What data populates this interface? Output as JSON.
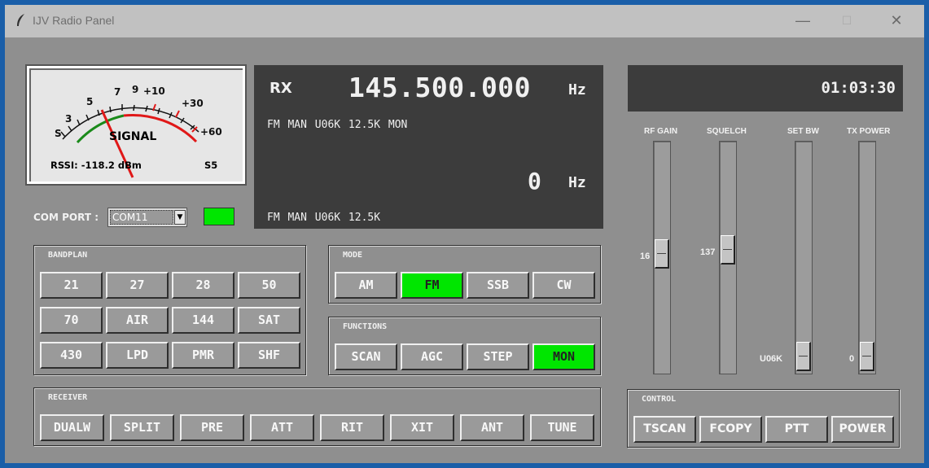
{
  "window": {
    "title": "IJV Radio Panel",
    "icon": "feather-icon"
  },
  "meter": {
    "scale_labels": [
      "S",
      "3",
      "5",
      "7",
      "9",
      "+10",
      "+30",
      "+60"
    ],
    "title": "SIGNAL",
    "rssi": "RSSI: -118.2 dBm",
    "s_level": "S5"
  },
  "com_port": {
    "label": "COM PORT :",
    "value": "COM11",
    "status_color": "#00e600"
  },
  "display": {
    "rx_label": "RX",
    "frequency": "145.500.000",
    "unit": "Hz",
    "status_line": "FM  MAN  U06K 12.5K MON",
    "offset": "0",
    "offset_unit": "Hz",
    "status_line2": "FM  MAN  U06K 12.5K"
  },
  "clock": "01:03:30",
  "bandplan": {
    "title": "BANDPLAN",
    "buttons": [
      "21",
      "27",
      "28",
      "50",
      "70",
      "AIR",
      "144",
      "SAT",
      "430",
      "LPD",
      "PMR",
      "SHF"
    ]
  },
  "mode": {
    "title": "MODE",
    "buttons": [
      "AM",
      "FM",
      "SSB",
      "CW"
    ],
    "active": "FM"
  },
  "functions": {
    "title": "FUNCTIONS",
    "buttons": [
      "SCAN",
      "AGC",
      "STEP",
      "MON"
    ],
    "active": "MON"
  },
  "receiver": {
    "title": "RECEIVER",
    "buttons": [
      "DUALW",
      "SPLIT",
      "PRE",
      "ATT",
      "RIT",
      "XIT",
      "ANT",
      "TUNE"
    ]
  },
  "sliders": [
    {
      "label": "RF GAIN",
      "value": "16"
    },
    {
      "label": "SQUELCH",
      "value": "137"
    },
    {
      "label": "SET BW",
      "value": "U06K"
    },
    {
      "label": "TX POWER",
      "value": "0"
    }
  ],
  "control": {
    "title": "CONTROL",
    "buttons": [
      "TSCAN",
      "FCOPY",
      "PTT",
      "POWER"
    ]
  },
  "colors": {
    "active_green": "#00e600",
    "display_bg": "#3c3c3c",
    "panel_bg": "#8f8f8f"
  }
}
